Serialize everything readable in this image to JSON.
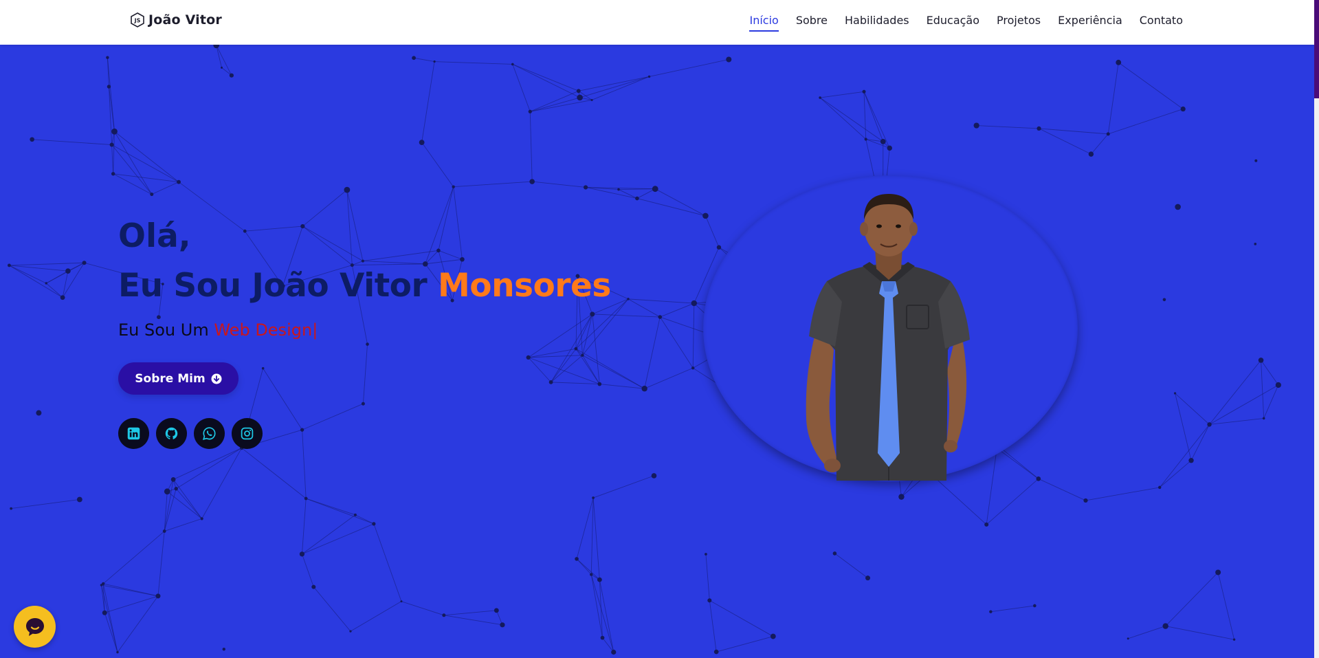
{
  "nav": {
    "brand": "João Vitor",
    "links": [
      {
        "label": "Início",
        "active": true
      },
      {
        "label": "Sobre",
        "active": false
      },
      {
        "label": "Habilidades",
        "active": false
      },
      {
        "label": "Educação",
        "active": false
      },
      {
        "label": "Projetos",
        "active": false
      },
      {
        "label": "Experiência",
        "active": false
      },
      {
        "label": "Contato",
        "active": false
      }
    ]
  },
  "hero": {
    "greeting": "Olá,",
    "name_prefix": "Eu Sou João Vitor",
    "name_accent": "Monsores",
    "role_prefix": "Eu Sou Um",
    "role_typed": "Web Design",
    "cursor": "|",
    "button_label": "Sobre Mim",
    "socials": [
      {
        "icon": "linkedin-icon"
      },
      {
        "icon": "github-icon"
      },
      {
        "icon": "whatsapp-icon"
      },
      {
        "icon": "instagram-icon"
      }
    ]
  },
  "colors": {
    "background": "#2b3ae0",
    "heading": "#0d1c64",
    "accent_orange": "#ff7a1a",
    "typed_red": "#c9171d",
    "button": "#2a0fa5",
    "social_bg": "#0a0b1e",
    "social_icon": "#1ec8e6",
    "chat_bubble": "#f5be1f",
    "nav_active": "#2b3ae0"
  },
  "chat": {
    "icon": "chat-icon"
  }
}
